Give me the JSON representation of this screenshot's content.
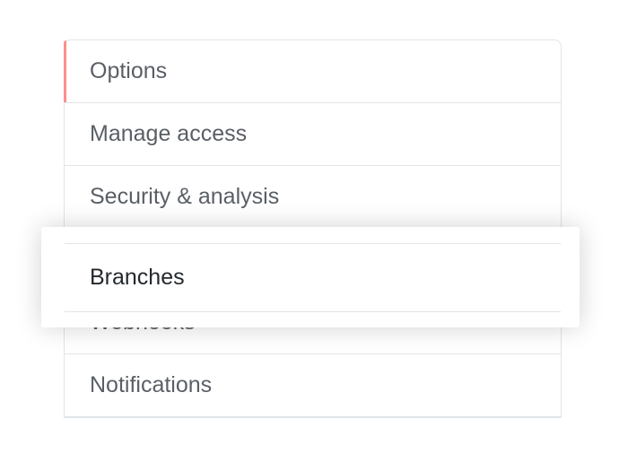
{
  "sidebar": {
    "items": [
      {
        "label": "Options"
      },
      {
        "label": "Manage access"
      },
      {
        "label": "Security & analysis"
      },
      {
        "label": "Branches"
      },
      {
        "label": "Webhooks"
      },
      {
        "label": "Notifications"
      }
    ]
  }
}
